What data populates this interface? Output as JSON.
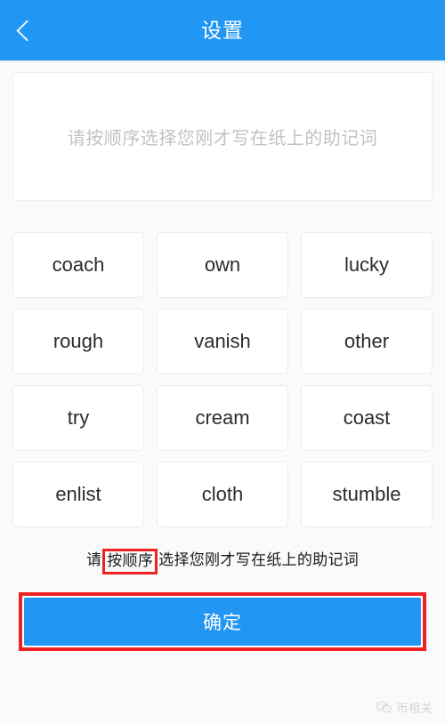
{
  "header": {
    "title": "设置",
    "back_icon": "chevron-left-icon",
    "background_color": "#2196f3"
  },
  "selected_area": {
    "placeholder": "请按顺序选择您刚才写在纸上的助记词",
    "value": ""
  },
  "word_grid": {
    "words": [
      "coach",
      "own",
      "lucky",
      "rough",
      "vanish",
      "other",
      "try",
      "cream",
      "coast",
      "enlist",
      "cloth",
      "stumble"
    ]
  },
  "hint": {
    "prefix": "请",
    "highlighted": "按顺序",
    "suffix": "选择您刚才写在纸上的助记词",
    "highlight_color": "#ee2222"
  },
  "confirm": {
    "label": "确定",
    "button_color": "#2196f3",
    "annotation_color": "#ee2222"
  },
  "watermark": {
    "icon": "wechat-icon",
    "text": "币相关"
  }
}
